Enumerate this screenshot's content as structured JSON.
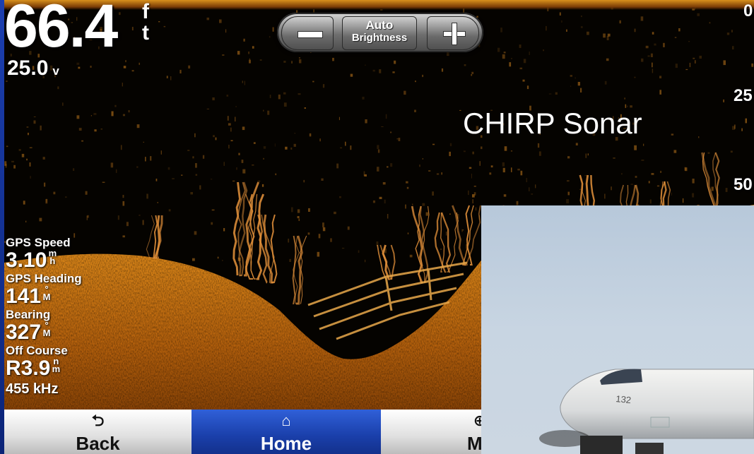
{
  "depth": {
    "value": "66.4",
    "unit_top": "f",
    "unit_bottom": "t"
  },
  "voltage": {
    "value": "25.0",
    "unit": "v"
  },
  "brightness": {
    "auto_label": "Auto",
    "auto_sub": "Brightness"
  },
  "scale": [
    "0",
    "25",
    "50"
  ],
  "title": "CHIRP Sonar",
  "data_fields": [
    {
      "label": "GPS Speed",
      "value": "3.10",
      "unit_top": "m",
      "unit_bottom": "h"
    },
    {
      "label": "GPS Heading",
      "value": "141",
      "unit_top": "°",
      "unit_bottom": "M"
    },
    {
      "label": "Bearing",
      "value": "327",
      "unit_top": "°",
      "unit_bottom": "M"
    },
    {
      "label": "Off Course",
      "value": "R3.9",
      "unit_top": "n",
      "unit_bottom": "m"
    }
  ],
  "frequency": "455 kHz",
  "nav": {
    "back": "Back",
    "home": "Home",
    "map": "Ma"
  },
  "photo": {
    "aircraft_number": "132"
  },
  "colors": {
    "sonar_gold": "#e29a2a",
    "nav_active": "#1a3faa",
    "slide_bg": "#0d2e8a"
  }
}
